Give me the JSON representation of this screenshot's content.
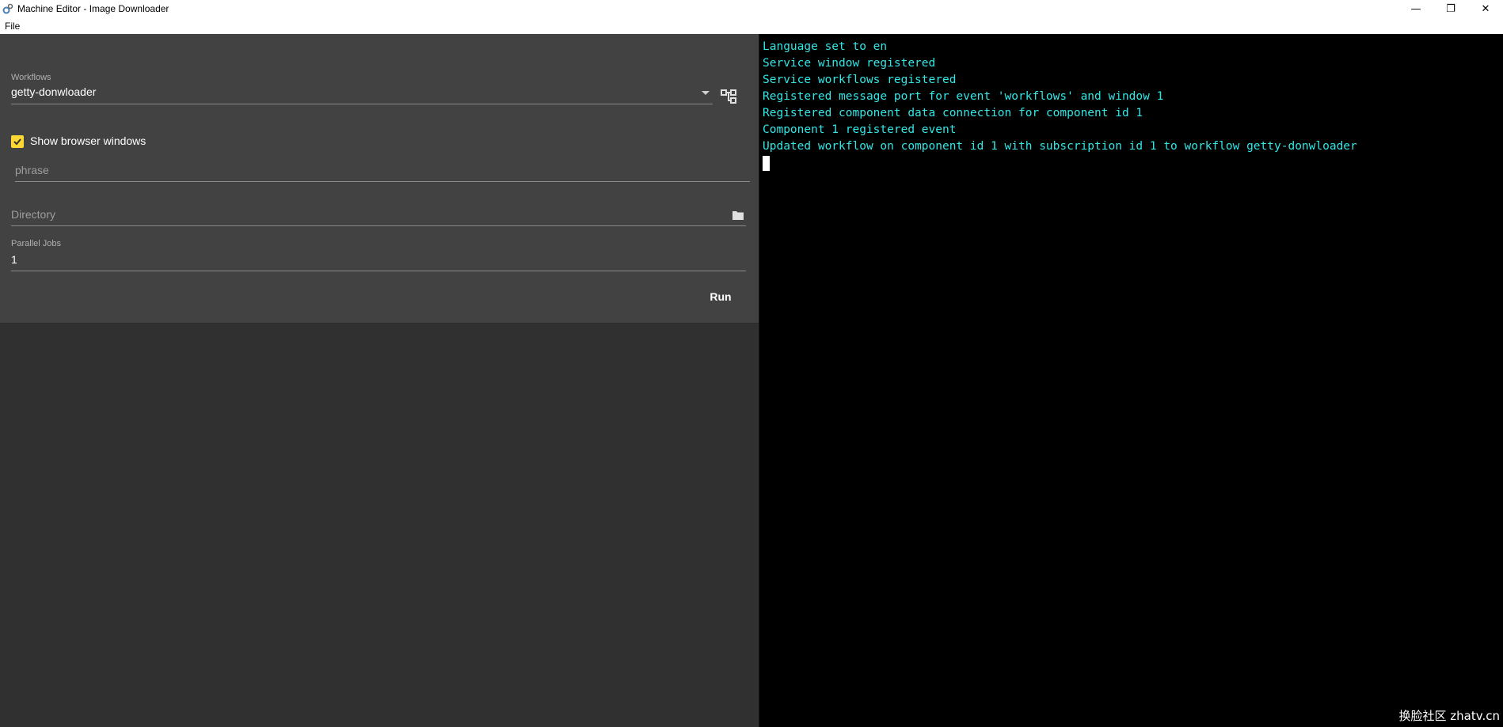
{
  "window": {
    "title": "Machine Editor - Image Downloader",
    "minimize": "—",
    "restore": "❐",
    "close": "✕"
  },
  "menu": {
    "items": [
      "File"
    ]
  },
  "form": {
    "workflows_label": "Workflows",
    "workflows_value": "getty-donwloader",
    "show_browser_label": "Show browser windows",
    "show_browser_checked": true,
    "phrase_placeholder": "phrase",
    "directory_placeholder": "Directory",
    "parallel_jobs_label": "Parallel Jobs",
    "parallel_jobs_value": "1",
    "run_label": "Run"
  },
  "console": {
    "lines": [
      "Language set to en",
      "Service window registered",
      "Service workflows registered",
      "Registered message port for event 'workflows' and window 1",
      "Registered component data connection for component id 1",
      "Component 1 registered event",
      "Updated workflow on component id 1 with subscription id 1 to workflow getty-donwloader"
    ]
  },
  "watermark": "换脸社区 zhatv.cn",
  "colors": {
    "panel": "#424242",
    "background": "#303030",
    "console_bg": "#000000",
    "console_text": "#33e6e6",
    "checkbox": "#fdd835"
  }
}
